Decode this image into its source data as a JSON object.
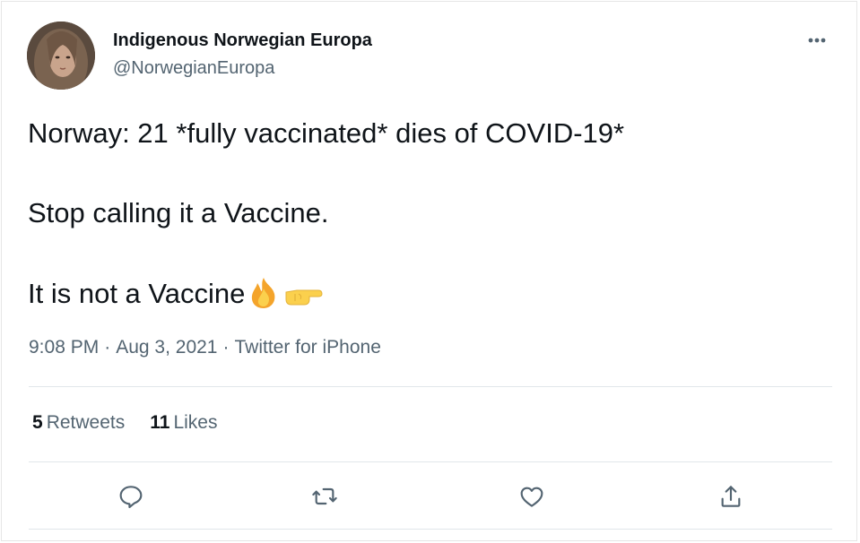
{
  "author": {
    "display_name": "Indigenous Norwegian Europa",
    "handle": "@NorwegianEuropa",
    "avatar_icon": "profile-photo-avatar"
  },
  "tweet": {
    "lines": [
      "Norway: 21 *fully vaccinated* dies of COVID-19*",
      "Stop calling it a Vaccine.",
      "It is not a Vaccine"
    ],
    "emojis": [
      "fire-emoji",
      "backhand-index-pointing-right-emoji"
    ]
  },
  "meta": {
    "time": "9:08 PM",
    "separator": "·",
    "date": "Aug 3, 2021",
    "source": "Twitter for iPhone"
  },
  "stats": {
    "retweets_count": "5",
    "retweets_label": "Retweets",
    "likes_count": "11",
    "likes_label": "Likes"
  },
  "actions": [
    "reply-icon",
    "retweet-icon",
    "like-icon",
    "share-icon"
  ],
  "more_icon": "more-options-icon",
  "colors": {
    "text_primary": "#0f1419",
    "text_secondary": "#536471",
    "divider": "#e1e6ea"
  }
}
